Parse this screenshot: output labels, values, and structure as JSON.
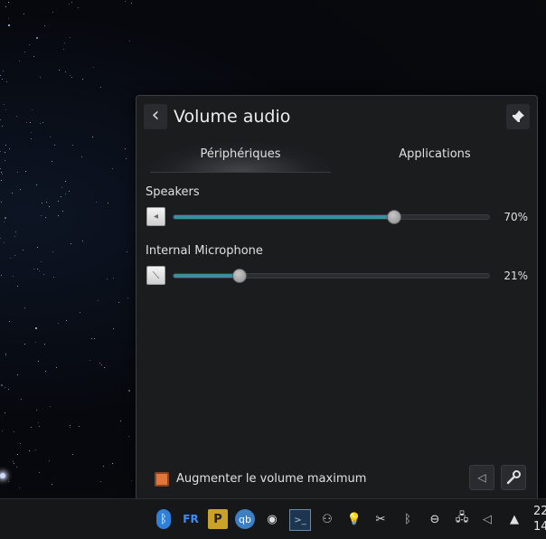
{
  "popup": {
    "title": "Volume audio",
    "back_icon": "chevron-left-icon",
    "pin_icon": "pin-icon",
    "tabs": [
      {
        "label": "Périphériques",
        "active": true
      },
      {
        "label": "Applications",
        "active": false
      }
    ],
    "devices": [
      {
        "name": "Speakers",
        "volume_percent": 70,
        "percent_text": "70%",
        "icon": "speaker-icon"
      },
      {
        "name": "Internal Microphone",
        "volume_percent": 21,
        "percent_text": "21%",
        "icon": "microphone-icon"
      }
    ],
    "raise_max_volume": {
      "label": "Augmenter le volume maximum",
      "checked": true
    },
    "footer_buttons": [
      "speaker-icon",
      "configure-icon"
    ]
  },
  "taskbar": {
    "tray_items": [
      {
        "name": "bluetooth-icon",
        "glyph": "ᛒ",
        "color": "#3da5ff"
      },
      {
        "name": "keyboard-layout-indicator",
        "glyph": "FR",
        "color": "#3d8bff"
      },
      {
        "name": "clipboard-icon",
        "glyph": "P",
        "color": "#f0c020"
      },
      {
        "name": "qbittorrent-icon",
        "glyph": "qb",
        "color": "#4aa3e6"
      },
      {
        "name": "steam-icon",
        "glyph": "◉",
        "color": "#e0e0e0"
      },
      {
        "name": "terminal-icon",
        "glyph": ">_",
        "color": "#9ec6e0"
      },
      {
        "name": "user-status-icon",
        "glyph": "⚇",
        "color": "#d0d0d0"
      },
      {
        "name": "lightbulb-icon",
        "glyph": "💡",
        "color": "#ffffff"
      },
      {
        "name": "scissors-icon",
        "glyph": "✂",
        "color": "#e0e0e0"
      },
      {
        "name": "bluetooth-tray-icon",
        "glyph": "ᛒ",
        "color": "#d0d0d0"
      },
      {
        "name": "usb-icon",
        "glyph": "⊖",
        "color": "#e0e0e0"
      },
      {
        "name": "network-icon",
        "glyph": "🖧",
        "color": "#e0e0e0"
      },
      {
        "name": "audio-volume-icon",
        "glyph": "◁",
        "color": "#b0b0b0"
      },
      {
        "name": "chevron-up-icon",
        "glyph": "▲",
        "color": "#e0e0e0"
      }
    ],
    "clock_line1": "22",
    "clock_line2": "14"
  },
  "colors": {
    "accent": "#3a8f9e",
    "panel_bg": "#1b1c1e",
    "checkbox": "#e0763a"
  }
}
